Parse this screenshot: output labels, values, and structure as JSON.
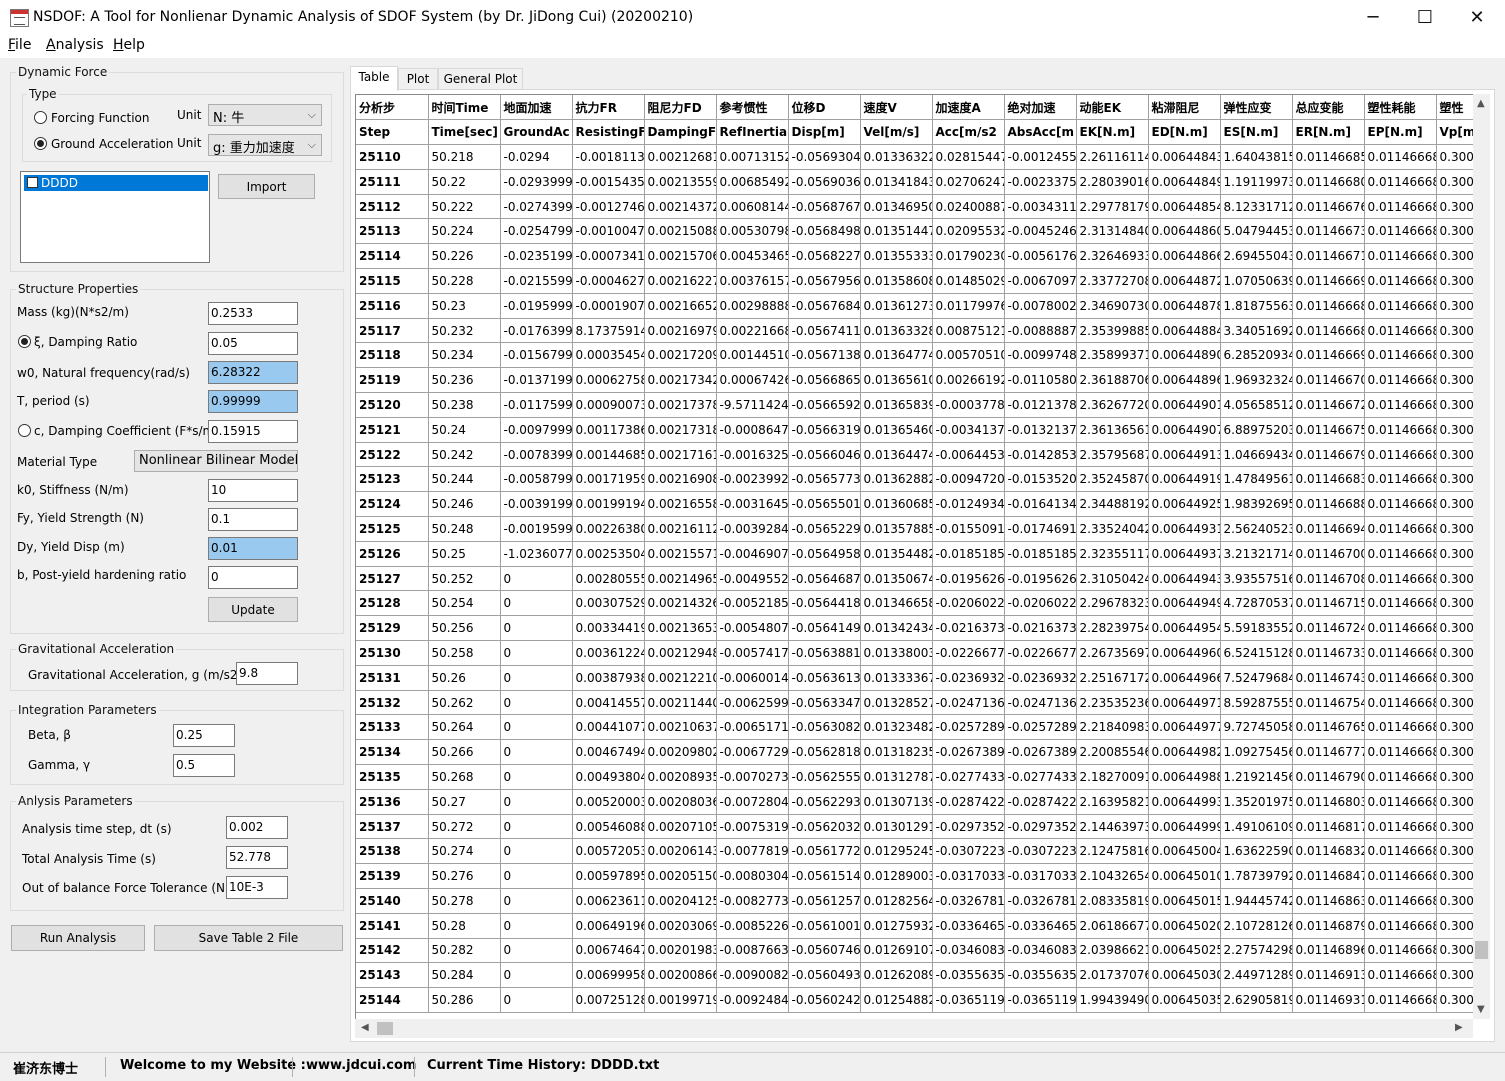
{
  "window": {
    "title": "NSDOF: A Tool for Nonlienar Dynamic Analysis of SDOF System (by Dr. JiDong Cui) (20200210)",
    "minimize": "─",
    "maximize": "☐",
    "close": "✕"
  },
  "menu": {
    "file": "ile",
    "file_key": "F",
    "analysis": "nalysis",
    "analysis_key": "A",
    "help": "elp",
    "help_key": "H"
  },
  "dynamic_force": {
    "title": "Dynamic Force",
    "type_title": "Type",
    "forcing_function": "Forcing Function",
    "ground_acceleration": "Ground Acceleration",
    "selected": "ground_acceleration",
    "unit_label": "Unit",
    "unit_force": "N: 牛",
    "unit_accel": "g: 重力加速度",
    "list_item": "DDDD",
    "import_button": "Import"
  },
  "structure": {
    "title": "Structure Properties",
    "mass_label": "Mass (kg)(N*s2/m)",
    "mass_value": "0.2533",
    "damping_ratio_label": "ξ, Damping Ratio",
    "damping_ratio_value": "0.05",
    "freq_label": "w0, Natural frequency(rad/s)",
    "freq_value": "6.28322",
    "period_label": "T, period (s)",
    "period_value": "0.99999",
    "damping_coeff_label": "c, Damping Coefficient (F*s/m)",
    "damping_coeff_value": "0.15915",
    "damping_selected": "ratio",
    "material_label": "Material Type",
    "material_value": "Nonlinear Bilinear Model",
    "k0_label": "k0, Stiffness (N/m)",
    "k0_value": "10",
    "fy_label": "Fy, Yield Strength (N)",
    "fy_value": "0.1",
    "dy_label": "Dy, Yield Disp (m)",
    "dy_value": "0.01",
    "b_label": "b, Post-yield hardening ratio",
    "b_value": "0",
    "update_button": "Update"
  },
  "gravity": {
    "title": "Gravitational Acceleration",
    "label": "Gravitational Acceleration, g (m/s2)",
    "value": "9.8"
  },
  "integration": {
    "title": "Integration Parameters",
    "beta_label": "Beta, β",
    "beta_value": "0.25",
    "gamma_label": "Gamma, γ",
    "gamma_value": "0.5"
  },
  "analysis_params": {
    "title": "Anlysis Parameters",
    "dt_label": "Analysis time step, dt (s)",
    "dt_value": "0.002",
    "total_label": "Total Analysis Time (s)",
    "total_value": "52.778",
    "tol_label": "Out of balance Force Tolerance (N)",
    "tol_value": "10E-3"
  },
  "buttons": {
    "run": "Run Analysis",
    "save": "Save Table 2 File"
  },
  "tabs": [
    "Table",
    "Plot",
    "General Plot"
  ],
  "table": {
    "header_cn": [
      "分析步",
      "时间Time",
      "地面加速",
      "抗力FR",
      "阻尼力FD",
      "参考惯性",
      "位移D",
      "速度V",
      "加速度A",
      "绝对加速",
      "动能EK",
      "粘滞阻尼",
      "弹性应变",
      "总应变能",
      "塑性耗能",
      "塑性"
    ],
    "header_en": [
      "Step",
      "Time[sec]",
      "GroundAc",
      "ResistingF",
      "DampingF",
      "RefInertia",
      "Disp[m]",
      "Vel[m/s]",
      "Acc[m/s2",
      "AbsAcc[m",
      "EK[N.m]",
      "ED[N.m]",
      "ES[N.m]",
      "ER[N.m]",
      "EP[N.m]",
      "Vp[m"
    ],
    "rows": [
      [
        "25110",
        "50.218",
        "-0.0294",
        "-0.0018113",
        "0.00212681",
        "0.00713152",
        "-0.0569304",
        "0.01336322",
        "0.02815447",
        "-0.0012455",
        "2.26116114",
        "0.00644843",
        "1.64043815",
        "0.01146685",
        "0.01146668",
        "0.300"
      ],
      [
        "25111",
        "50.22",
        "-0.0293999",
        "-0.0015435",
        "0.00213559",
        "0.00685492",
        "-0.0569036",
        "0.01341843",
        "0.02706247",
        "-0.0023375",
        "2.28039016",
        "0.00644849",
        "1.19119973",
        "0.01146680",
        "0.01146668",
        "0.300"
      ],
      [
        "25112",
        "50.222",
        "-0.0274399",
        "-0.0012746",
        "0.00214372",
        "0.00608144",
        "-0.0568767",
        "0.01346950",
        "0.02400887",
        "-0.0034311",
        "2.29778179",
        "0.00644854",
        "8.12331712",
        "0.01146676",
        "0.01146668",
        "0.300"
      ],
      [
        "25113",
        "50.224",
        "-0.0254799",
        "-0.0010047",
        "0.00215088",
        "0.00530798",
        "-0.0568498",
        "0.01351447",
        "0.02095532",
        "-0.0045246",
        "2.31314840",
        "0.00644860",
        "5.04794453",
        "0.01146673",
        "0.01146668",
        "0.300"
      ],
      [
        "25114",
        "50.226",
        "-0.0235199",
        "-0.0007341",
        "0.00215706",
        "0.00453465",
        "-0.0568227",
        "0.01355333",
        "0.01790230",
        "-0.0056176",
        "2.32646933",
        "0.00644866",
        "2.69455043",
        "0.01146671",
        "0.01146668",
        "0.300"
      ],
      [
        "25115",
        "50.228",
        "-0.0215599",
        "-0.0004627",
        "0.00216227",
        "0.00376157",
        "-0.0567956",
        "0.01358608",
        "0.01485029",
        "-0.0067097",
        "2.33772708",
        "0.00644872",
        "1.07050639",
        "0.01146669",
        "0.01146668",
        "0.300"
      ],
      [
        "25116",
        "50.23",
        "-0.0195999",
        "-0.0001907",
        "0.00216652",
        "0.00298888",
        "-0.0567684",
        "0.01361273",
        "0.01179976",
        "-0.0078002",
        "2.34690730",
        "0.00644878",
        "1.81875563",
        "0.01146668",
        "0.01146668",
        "0.300"
      ],
      [
        "25117",
        "50.232",
        "-0.0176399",
        "8.17375914",
        "0.00216979",
        "0.00221668",
        "-0.0567411",
        "0.01363328",
        "0.00875121",
        "-0.0088887",
        "2.35399885",
        "0.00644884",
        "3.34051692",
        "0.01146668",
        "0.01146668",
        "0.300"
      ],
      [
        "25118",
        "50.234",
        "-0.0156799",
        "0.00035454",
        "0.00217209",
        "0.00144510",
        "-0.0567138",
        "0.01364774",
        "0.00570510",
        "-0.0099748",
        "2.35899371",
        "0.00644890",
        "6.28520934",
        "0.01146669",
        "0.01146668",
        "0.300"
      ],
      [
        "25119",
        "50.236",
        "-0.0137199",
        "0.00062758",
        "0.00217342",
        "0.00067426",
        "-0.0566865",
        "0.01365610",
        "0.00266192",
        "-0.0110580",
        "2.36188706",
        "0.00644896",
        "1.96932324",
        "0.01146670",
        "0.01146668",
        "0.300"
      ],
      [
        "25120",
        "50.238",
        "-0.0117599",
        "0.00090073",
        "0.00217378",
        "-9.5711424",
        "-0.0566592",
        "0.01365839",
        "-0.0003778",
        "-0.0121378",
        "2.36267720",
        "0.00644901",
        "4.05658512",
        "0.01146672",
        "0.01146668",
        "0.300"
      ],
      [
        "25121",
        "50.24",
        "-0.0097999",
        "0.00117386",
        "0.00217318",
        "-0.0008647",
        "-0.0566319",
        "0.01365460",
        "-0.0034137",
        "-0.0132137",
        "2.36136561",
        "0.00644907",
        "6.88975203",
        "0.01146675",
        "0.01146668",
        "0.300"
      ],
      [
        "25122",
        "50.242",
        "-0.0078399",
        "0.00144685",
        "0.00217161",
        "-0.0016325",
        "-0.0566046",
        "0.01364474",
        "-0.0064453",
        "-0.0142853",
        "2.35795687",
        "0.00644913",
        "1.04669434",
        "0.01146679",
        "0.01146668",
        "0.300"
      ],
      [
        "25123",
        "50.244",
        "-0.0058799",
        "0.00171959",
        "0.00216908",
        "-0.0023992",
        "-0.0565773",
        "0.01362882",
        "-0.0094720",
        "-0.0153520",
        "2.35245870",
        "0.00644919",
        "1.47849561",
        "0.01146683",
        "0.01146668",
        "0.300"
      ],
      [
        "25124",
        "50.246",
        "-0.0039199",
        "0.00199194",
        "0.00216558",
        "-0.0031645",
        "-0.0565501",
        "0.01360685",
        "-0.0124934",
        "-0.0164134",
        "2.34488192",
        "0.00644925",
        "1.98392695",
        "0.01146688",
        "0.01146668",
        "0.300"
      ],
      [
        "25125",
        "50.248",
        "-0.0019599",
        "0.00226380",
        "0.00216112",
        "-0.0039284",
        "-0.0565229",
        "0.01357885",
        "-0.0155091",
        "-0.0174691",
        "2.33524042",
        "0.00644931",
        "2.56240523",
        "0.01146694",
        "0.01146668",
        "0.300"
      ],
      [
        "25126",
        "50.25",
        "-1.0236077",
        "0.00253504",
        "0.00215571",
        "-0.0046907",
        "-0.0564958",
        "0.01354482",
        "-0.0185185",
        "-0.0185185",
        "2.32355117",
        "0.00644937",
        "3.21321714",
        "0.01146700",
        "0.01146668",
        "0.300"
      ],
      [
        "25127",
        "50.252",
        "0",
        "0.00280555",
        "0.00214965",
        "-0.0049552",
        "-0.0564687",
        "0.01350674",
        "-0.0195626",
        "-0.0195626",
        "2.31050424",
        "0.00644943",
        "3.93557516",
        "0.01146708",
        "0.01146668",
        "0.300"
      ],
      [
        "25128",
        "50.254",
        "0",
        "0.00307529",
        "0.00214326",
        "-0.0052185",
        "-0.0564418",
        "0.01346658",
        "-0.0206022",
        "-0.0206022",
        "2.29678323",
        "0.00644949",
        "4.72870537",
        "0.01146715",
        "0.01146668",
        "0.300"
      ],
      [
        "25129",
        "50.256",
        "0",
        "0.00334419",
        "0.00213653",
        "-0.0054807",
        "-0.0564149",
        "0.01342434",
        "-0.0216373",
        "-0.0216373",
        "2.28239754",
        "0.00644954",
        "5.59183552",
        "0.01146724",
        "0.01146668",
        "0.300"
      ],
      [
        "25130",
        "50.258",
        "0",
        "0.00361224",
        "0.00212948",
        "-0.0057417",
        "-0.0563881",
        "0.01338003",
        "-0.0226677",
        "-0.0226677",
        "2.26735697",
        "0.00644960",
        "6.52415128",
        "0.01146733",
        "0.01146668",
        "0.300"
      ],
      [
        "25131",
        "50.26",
        "0",
        "0.00387938",
        "0.00212210",
        "-0.0060014",
        "-0.0563613",
        "0.01333367",
        "-0.0236932",
        "-0.0236932",
        "2.25167172",
        "0.00644966",
        "7.52479684",
        "0.01146743",
        "0.01146668",
        "0.300"
      ],
      [
        "25132",
        "50.262",
        "0",
        "0.00414557",
        "0.00211440",
        "-0.0062599",
        "-0.0563347",
        "0.01328527",
        "-0.0247136",
        "-0.0247136",
        "2.23535236",
        "0.00644971",
        "8.59287555",
        "0.01146754",
        "0.01146668",
        "0.300"
      ],
      [
        "25133",
        "50.264",
        "0",
        "0.00441077",
        "0.00210637",
        "-0.0065171",
        "-0.0563082",
        "0.01323482",
        "-0.0257289",
        "-0.0257289",
        "2.21840983",
        "0.00644977",
        "9.72745058",
        "0.01146765",
        "0.01146668",
        "0.300"
      ],
      [
        "25134",
        "50.266",
        "0",
        "0.00467494",
        "0.00209802",
        "-0.0067729",
        "-0.0562818",
        "0.01318235",
        "-0.0267389",
        "-0.0267389",
        "2.20085546",
        "0.00644982",
        "1.09275456",
        "0.01146777",
        "0.01146668",
        "0.300"
      ],
      [
        "25135",
        "50.268",
        "0",
        "0.00493804",
        "0.00208935",
        "-0.0070273",
        "-0.0562555",
        "0.01312787",
        "-0.0277433",
        "-0.0277433",
        "2.18270091",
        "0.00644988",
        "1.21921456",
        "0.01146790",
        "0.01146668",
        "0.300"
      ],
      [
        "25136",
        "50.27",
        "0",
        "0.00520003",
        "0.00208036",
        "-0.0072804",
        "-0.0562293",
        "0.01307139",
        "-0.0287422",
        "-0.0287422",
        "2.16395821",
        "0.00644993",
        "1.35201975",
        "0.01146803",
        "0.01146668",
        "0.300"
      ],
      [
        "25137",
        "50.272",
        "0",
        "0.00546088",
        "0.00207105",
        "-0.0075319",
        "-0.0562032",
        "0.01301291",
        "-0.0297352",
        "-0.0297352",
        "2.14463973",
        "0.00644999",
        "1.49106109",
        "0.01146817",
        "0.01146668",
        "0.300"
      ],
      [
        "25138",
        "50.274",
        "0",
        "0.00572053",
        "0.00206143",
        "-0.0077819",
        "-0.0561772",
        "0.01295245",
        "-0.0307223",
        "-0.0307223",
        "2.12475816",
        "0.00645004",
        "1.63622590",
        "0.01146832",
        "0.01146668",
        "0.300"
      ],
      [
        "25139",
        "50.276",
        "0",
        "0.00597895",
        "0.00205150",
        "-0.0080304",
        "-0.0561514",
        "0.01289003",
        "-0.0317033",
        "-0.0317033",
        "2.10432654",
        "0.00645010",
        "1.78739792",
        "0.01146847",
        "0.01146668",
        "0.300"
      ],
      [
        "25140",
        "50.278",
        "0",
        "0.00623611",
        "0.00204125",
        "-0.0082773",
        "-0.0561257",
        "0.01282564",
        "-0.0326781",
        "-0.0326781",
        "2.08335819",
        "0.00645015",
        "1.94445742",
        "0.01146863",
        "0.01146668",
        "0.300"
      ],
      [
        "25141",
        "50.28",
        "0",
        "0.00649196",
        "0.00203069",
        "-0.0085226",
        "-0.0561001",
        "0.01275932",
        "-0.0336465",
        "-0.0336465",
        "2.06186677",
        "0.00645020",
        "2.10728126",
        "0.01146879",
        "0.01146668",
        "0.300"
      ],
      [
        "25142",
        "50.282",
        "0",
        "0.00674647",
        "0.00201983",
        "-0.0087663",
        "-0.0560746",
        "0.01269107",
        "-0.0346083",
        "-0.0346083",
        "2.03986621",
        "0.00645025",
        "2.27574298",
        "0.01146896",
        "0.01146668",
        "0.300"
      ],
      [
        "25143",
        "50.284",
        "0",
        "0.00699958",
        "0.00200866",
        "-0.0090082",
        "-0.0560493",
        "0.01262089",
        "-0.0355635",
        "-0.0355635",
        "2.01737076",
        "0.00645030",
        "2.44971289",
        "0.01146913",
        "0.01146668",
        "0.300"
      ],
      [
        "25144",
        "50.286",
        "0",
        "0.00725128",
        "0.00199719",
        "-0.0092484",
        "-0.0560242",
        "0.01254882",
        "-0.0365119",
        "-0.0365119",
        "1.99439490",
        "0.00645035",
        "2.62905819",
        "0.01146931",
        "0.01146668",
        "0.300"
      ]
    ]
  },
  "statusbar": {
    "author": "崔济东博士",
    "welcome": "Welcome to my Website :",
    "website": "www.jdcui.com",
    "history": "Current Time History: DDDD.txt"
  }
}
